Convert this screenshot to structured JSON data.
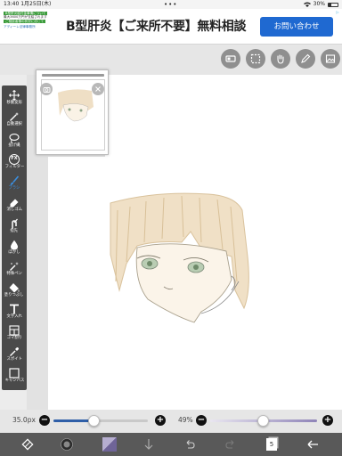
{
  "status_bar": {
    "time": "13:40",
    "date": "1月25日(木)",
    "dots": "•••",
    "battery": "30%"
  },
  "ad": {
    "headline": "B型肝炎【ご来所不要】無料相談",
    "cta": "お問い合わせ",
    "thumb_line1": "B型肝炎給付金事情について",
    "thumb_line2": "最大3600万円が支給されます",
    "thumb_line3": "ご相談者様の状況に応じて",
    "thumb_brand": "アディーレ法律事務所"
  },
  "top_toolbar": {
    "buttons": [
      "layer-icon",
      "selection-icon",
      "hand-icon",
      "edit-icon",
      "image-icon"
    ]
  },
  "tools": [
    {
      "label": "移動変形",
      "icon": "move-icon",
      "active": false
    },
    {
      "label": "自動選択",
      "icon": "magic-wand-icon",
      "active": false
    },
    {
      "label": "投げ縄",
      "icon": "lasso-icon",
      "active": false
    },
    {
      "label": "フィルター",
      "icon": "fx-icon",
      "active": false
    },
    {
      "label": "ブラシ",
      "icon": "brush-icon",
      "active": true
    },
    {
      "label": "消しゴム",
      "icon": "eraser-icon",
      "active": false
    },
    {
      "label": "指先",
      "icon": "smudge-icon",
      "active": false
    },
    {
      "label": "ぼかし",
      "icon": "blur-icon",
      "active": false
    },
    {
      "label": "特殊ペン",
      "icon": "special-pen-icon",
      "active": false
    },
    {
      "label": "塗りつぶし",
      "icon": "fill-icon",
      "active": false
    },
    {
      "label": "文字入れ",
      "icon": "text-icon",
      "active": false
    },
    {
      "label": "コマ割り",
      "icon": "frame-icon",
      "active": false
    },
    {
      "label": "スポイト",
      "icon": "eyedropper-icon",
      "active": false
    },
    {
      "label": "キャンバス",
      "icon": "canvas-icon",
      "active": false
    }
  ],
  "sliders": {
    "brush_size": "35.0px",
    "brush_size_fraction": 0.42,
    "opacity": "49%",
    "opacity_fraction": 0.49
  },
  "bottom_bar": {
    "layer_count": "5",
    "buttons": [
      "transform-icon",
      "brush-preview-icon",
      "color-swatch-icon",
      "download-icon",
      "undo-icon",
      "redo-icon",
      "layers-icon",
      "back-icon"
    ]
  },
  "colors": {
    "accent": "#3b8fe0",
    "palette_bg": "#4a4a4a",
    "bottombar_bg": "#595959",
    "ad_cta": "#1f69d1",
    "swatch": "#8a7fa8"
  }
}
